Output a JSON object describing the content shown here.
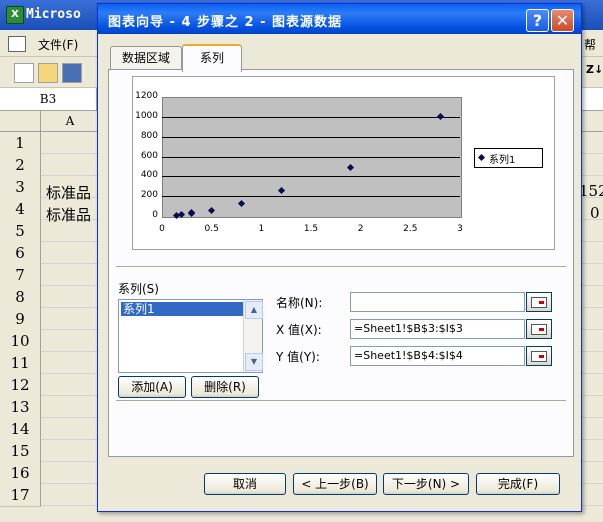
{
  "excel": {
    "app_title": "Microso",
    "menu": {
      "file": "文件(F)",
      "help": "帮"
    },
    "name_box": "B3",
    "column_a": "A",
    "rows": [
      "1",
      "2",
      "3",
      "4",
      "5",
      "6",
      "7",
      "8",
      "9",
      "10",
      "11",
      "12",
      "13",
      "14",
      "15",
      "16",
      "17"
    ],
    "cells": {
      "a3": "标准品",
      "a4": "标准品",
      "right3": "152",
      "right4": "0"
    }
  },
  "dialog": {
    "title": "图表向导 - 4 步骤之 2 - 图表源数据",
    "help_glyph": "?",
    "close_glyph": "✕",
    "tabs": [
      {
        "label": "数据区域",
        "active": false
      },
      {
        "label": "系列",
        "active": true
      }
    ],
    "series_section": {
      "label": "系列(S)",
      "items": [
        "系列1"
      ],
      "selected": "系列1",
      "add_button": "添加(A)",
      "remove_button": "删除(R)"
    },
    "fields": {
      "name_label": "名称(N):",
      "name_value": "",
      "x_label": "X 值(X):",
      "x_value": "=Sheet1!$B$3:$I$3",
      "y_label": "Y 值(Y):",
      "y_value": "=Sheet1!$B$4:$I$4"
    },
    "buttons": {
      "cancel": "取消",
      "back": "< 上一步(B)",
      "next": "下一步(N) >",
      "finish": "完成(F)"
    }
  },
  "chart_data": {
    "type": "scatter",
    "title": "",
    "xlabel": "",
    "ylabel": "",
    "xlim": [
      0,
      3
    ],
    "ylim": [
      0,
      1200
    ],
    "x_ticks": [
      "0",
      "0.5",
      "1",
      "1.5",
      "2",
      "2.5",
      "3"
    ],
    "y_ticks": [
      "0",
      "200",
      "400",
      "600",
      "800",
      "1000",
      "1200"
    ],
    "grid": true,
    "legend": "right",
    "series": [
      {
        "name": "系列1",
        "x": [
          0.15,
          0.2,
          0.3,
          0.3,
          0.5,
          0.8,
          1.2,
          1.9,
          2.8
        ],
        "y": [
          5,
          15,
          30,
          40,
          60,
          125,
          255,
          490,
          1000
        ]
      }
    ],
    "colors": {
      "marker": "#0a0a50",
      "plot_bg": "#c0c0c0"
    }
  }
}
